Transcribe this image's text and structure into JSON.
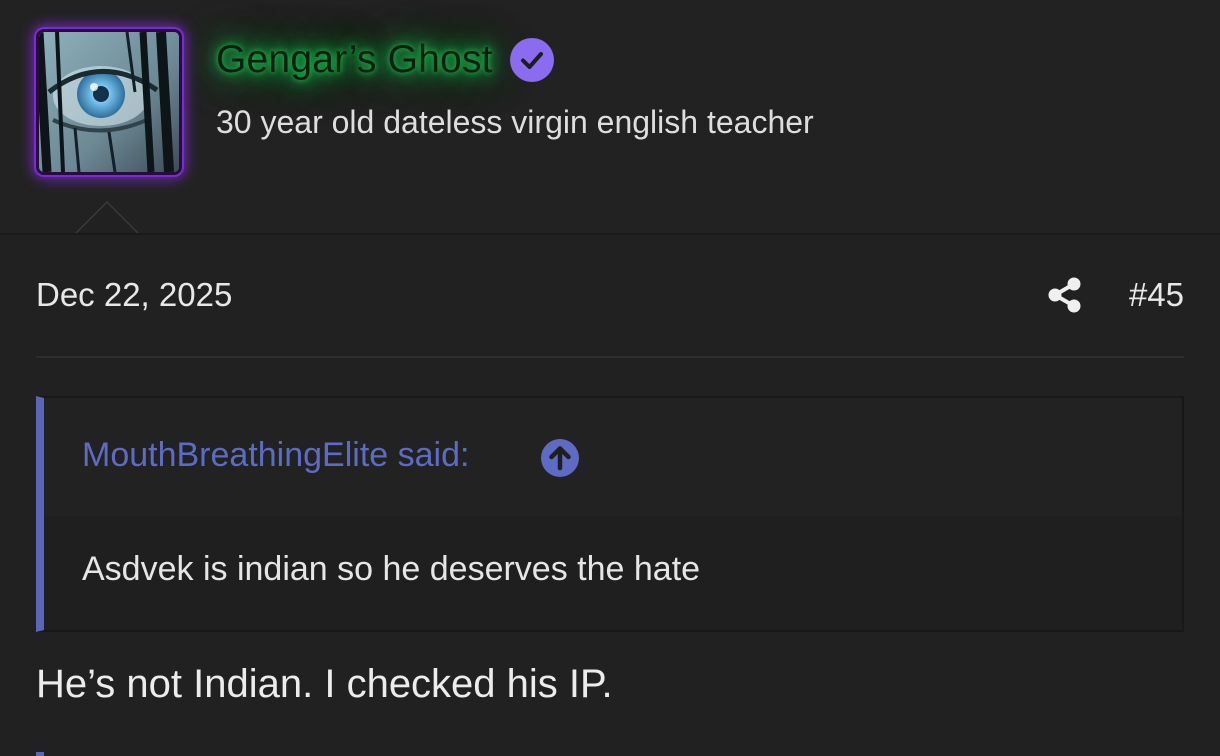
{
  "user": {
    "name": "Gengar’s Ghost",
    "title": "30 year old dateless virgin english teacher",
    "avatar_icon": "avatar-image",
    "verified_icon": "verified-check-icon",
    "name_glow_color": "#17b34a",
    "avatar_border_color": "#7a2bd6",
    "verified_color": "#8b6cf0"
  },
  "post": {
    "date": "Dec 22, 2025",
    "share_icon": "share-icon",
    "number": "#45"
  },
  "quote": {
    "author_label": "MouthBreathingElite said:",
    "jump_icon": "arrow-up-circle-icon",
    "text": "Asdvek is indian so he deserves the hate",
    "accent_color": "#5b66b8"
  },
  "reply": {
    "text": "He’s not Indian. I checked his IP."
  }
}
